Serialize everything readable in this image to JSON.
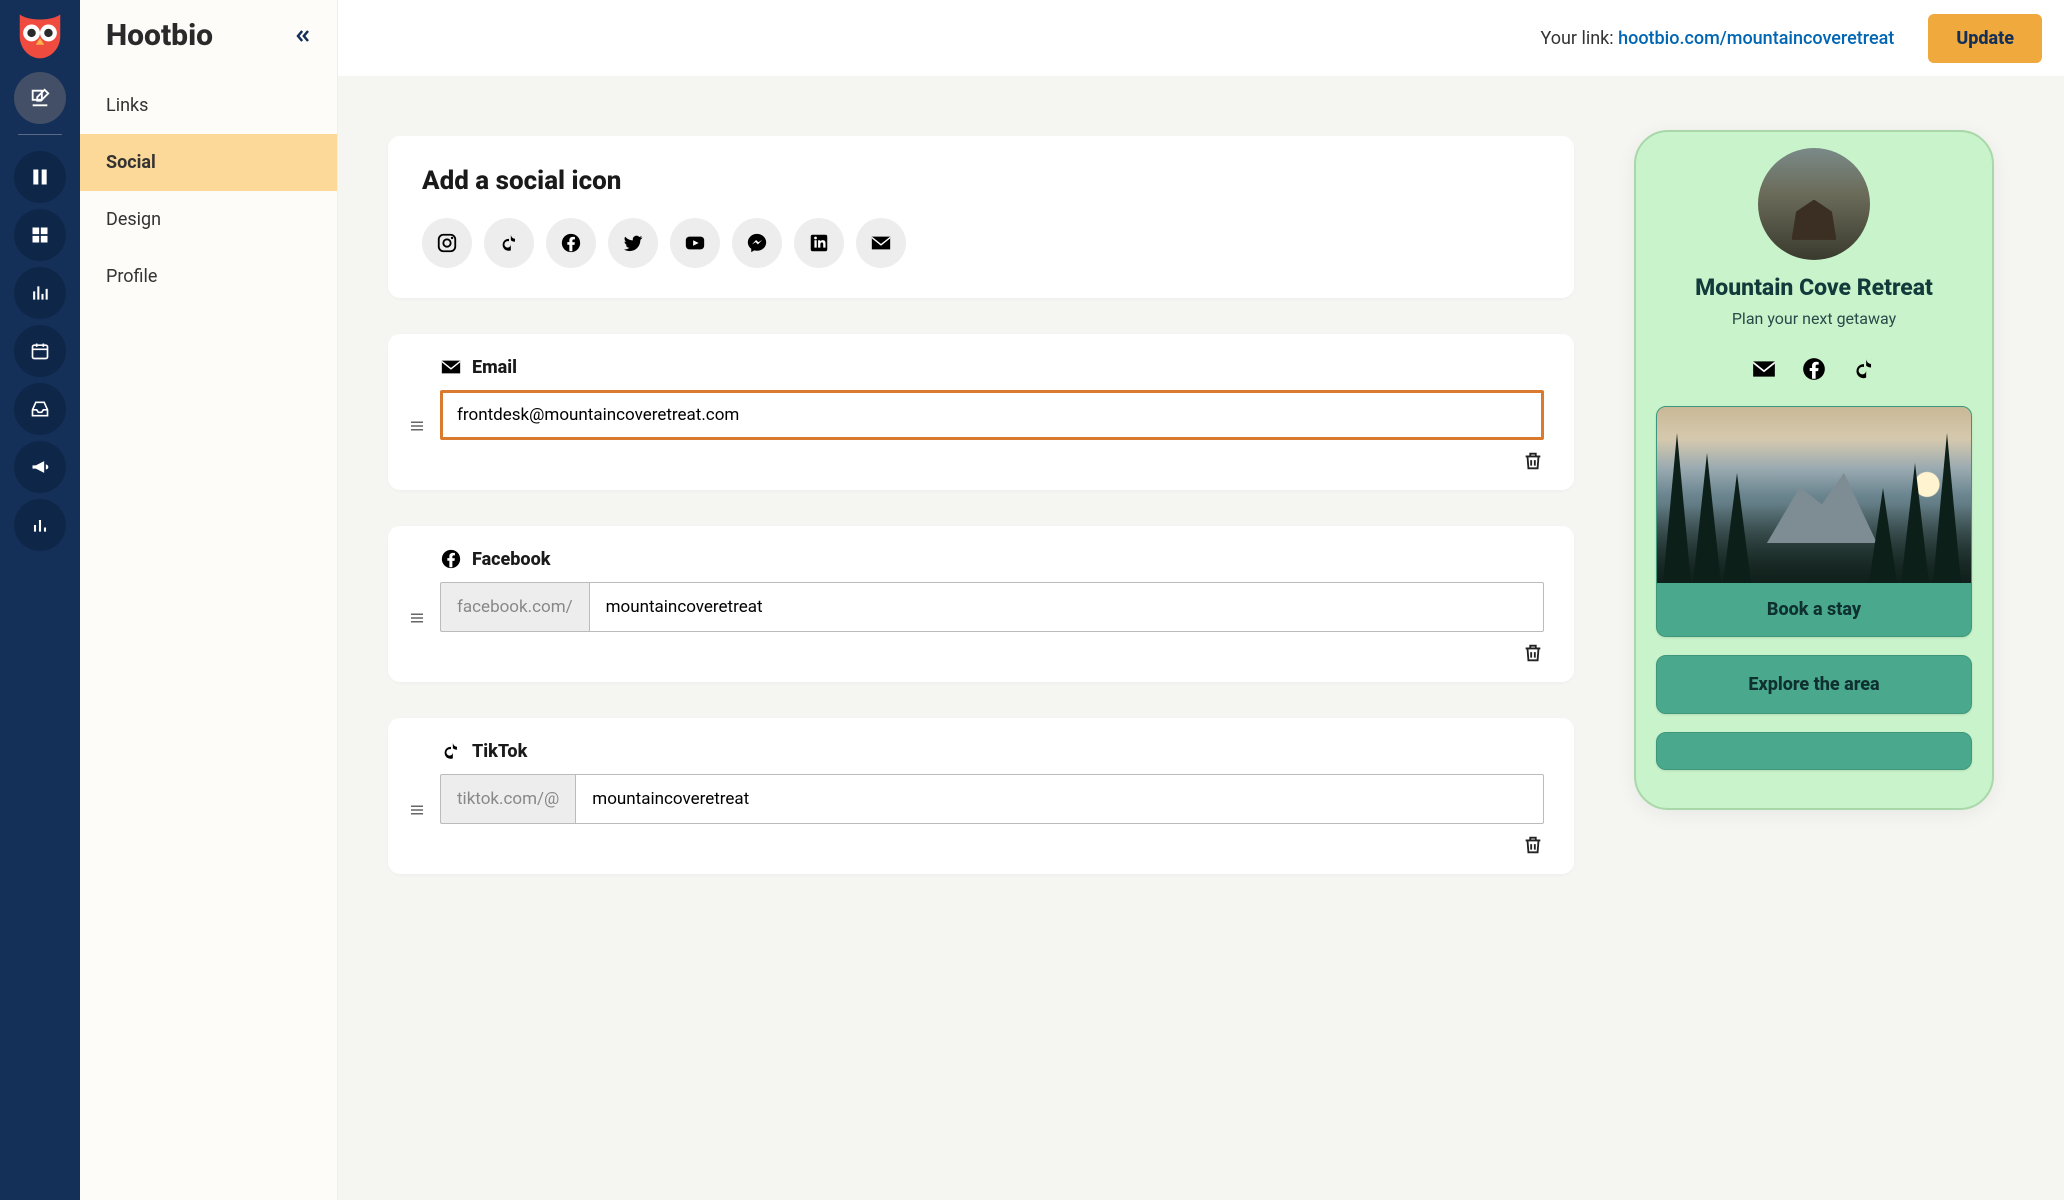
{
  "brand": "Hootbio",
  "sidebar": {
    "items": [
      "Links",
      "Social",
      "Design",
      "Profile"
    ],
    "active_index": 1
  },
  "topbar": {
    "your_link_label": "Your link:",
    "your_link_value": "hootbio.com/mountaincoveretreat",
    "update_label": "Update"
  },
  "add_social": {
    "title": "Add a social icon",
    "icons": [
      "instagram",
      "tiktok",
      "facebook",
      "twitter",
      "youtube",
      "messenger",
      "linkedin",
      "email"
    ]
  },
  "items": [
    {
      "icon": "email",
      "label": "Email",
      "prefix": null,
      "value": "frontdesk@mountaincoveretreat.com",
      "highlighted": true
    },
    {
      "icon": "facebook",
      "label": "Facebook",
      "prefix": "facebook.com/",
      "value": "mountaincoveretreat",
      "highlighted": false
    },
    {
      "icon": "tiktok",
      "label": "TikTok",
      "prefix": "tiktok.com/@",
      "value": "mountaincoveretreat",
      "highlighted": false
    }
  ],
  "preview": {
    "name": "Mountain Cove Retreat",
    "tagline": "Plan your next getaway",
    "socials": [
      "email",
      "facebook",
      "tiktok"
    ],
    "links": [
      {
        "label": "Book a stay",
        "has_image": true
      },
      {
        "label": "Explore the area",
        "has_image": false
      },
      {
        "label": "",
        "has_image": false
      }
    ]
  },
  "rail_icons": [
    "compose",
    "swatches",
    "grid",
    "bars",
    "calendar",
    "inbox",
    "megaphone",
    "analytics"
  ]
}
